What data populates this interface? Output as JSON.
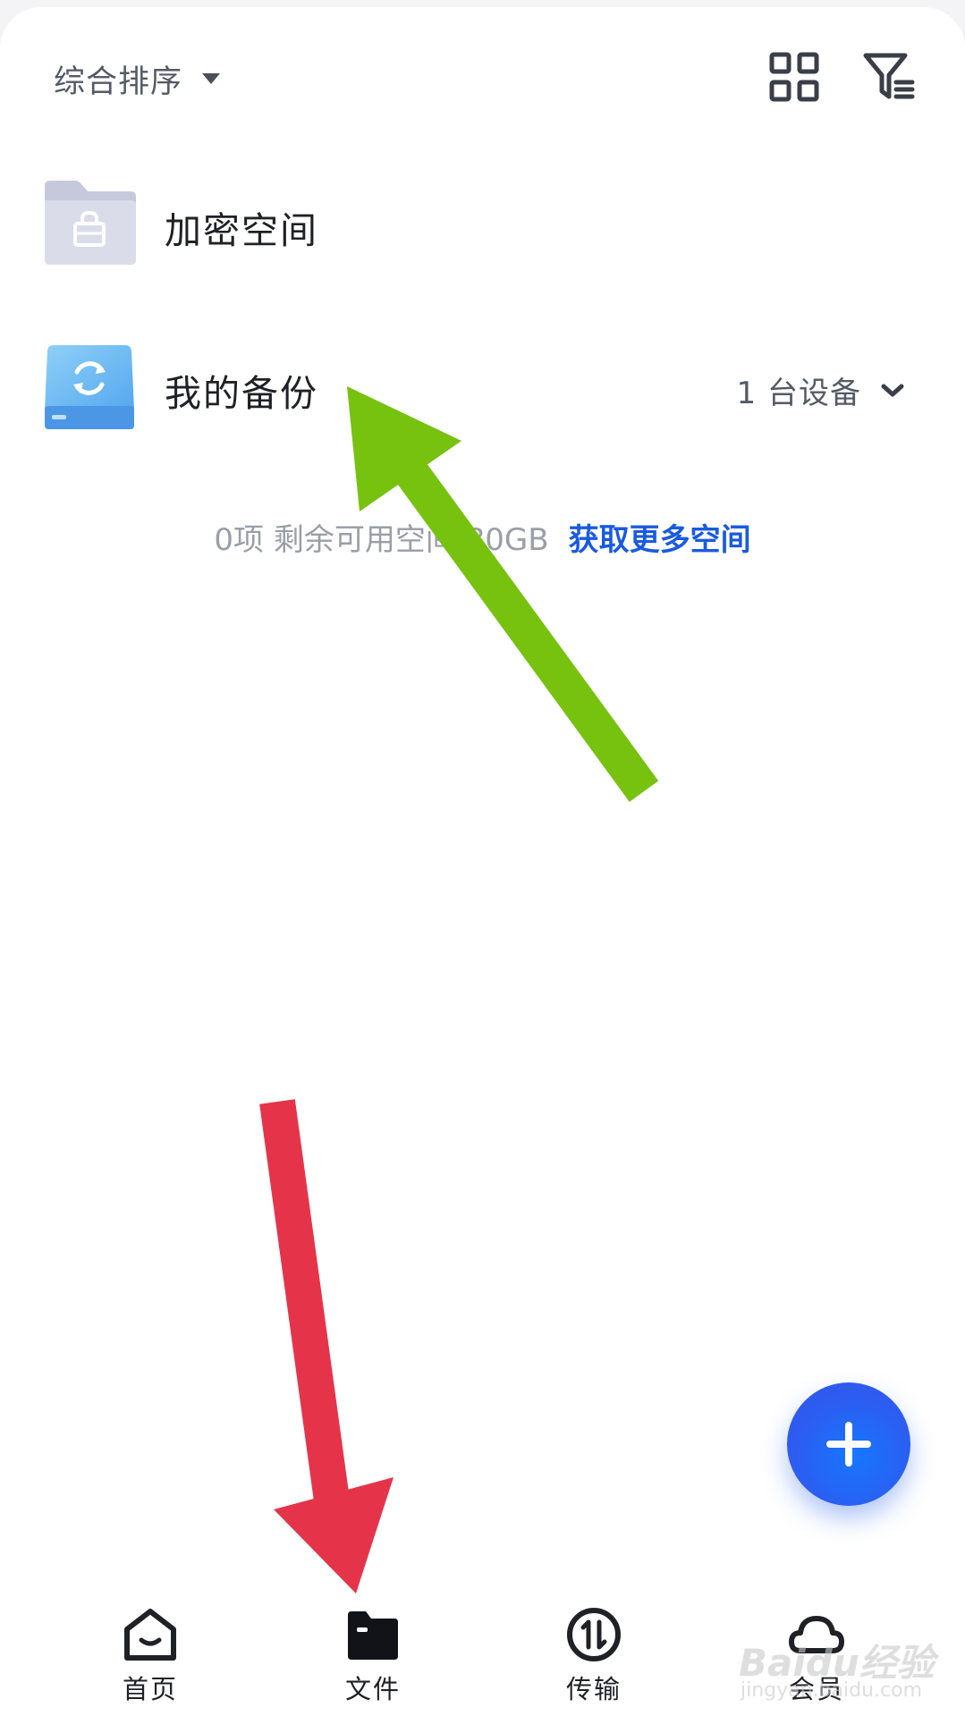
{
  "toolbar": {
    "sort_label": "综合排序",
    "icons": [
      "grid-view-icon",
      "filter-icon"
    ]
  },
  "rows": {
    "encrypted": {
      "title": "加密空间",
      "icon": "lock-folder-icon"
    },
    "backup": {
      "title": "我的备份",
      "icon": "backup-drive-icon",
      "device_count": "1 台设备"
    }
  },
  "storage": {
    "text": "0项 剩余可用空间 80GB",
    "link": "获取更多空间"
  },
  "nav": {
    "home": "首页",
    "files": "文件",
    "transfer": "传输",
    "member": "会员"
  },
  "watermark": {
    "brand": "Baidu经验",
    "url": "jingyan.baidu.com"
  },
  "colors": {
    "accent": "#1a5ae0",
    "fab": "#2d5cf0",
    "annotation_green": "#76c20e",
    "annotation_red": "#e5344a"
  }
}
